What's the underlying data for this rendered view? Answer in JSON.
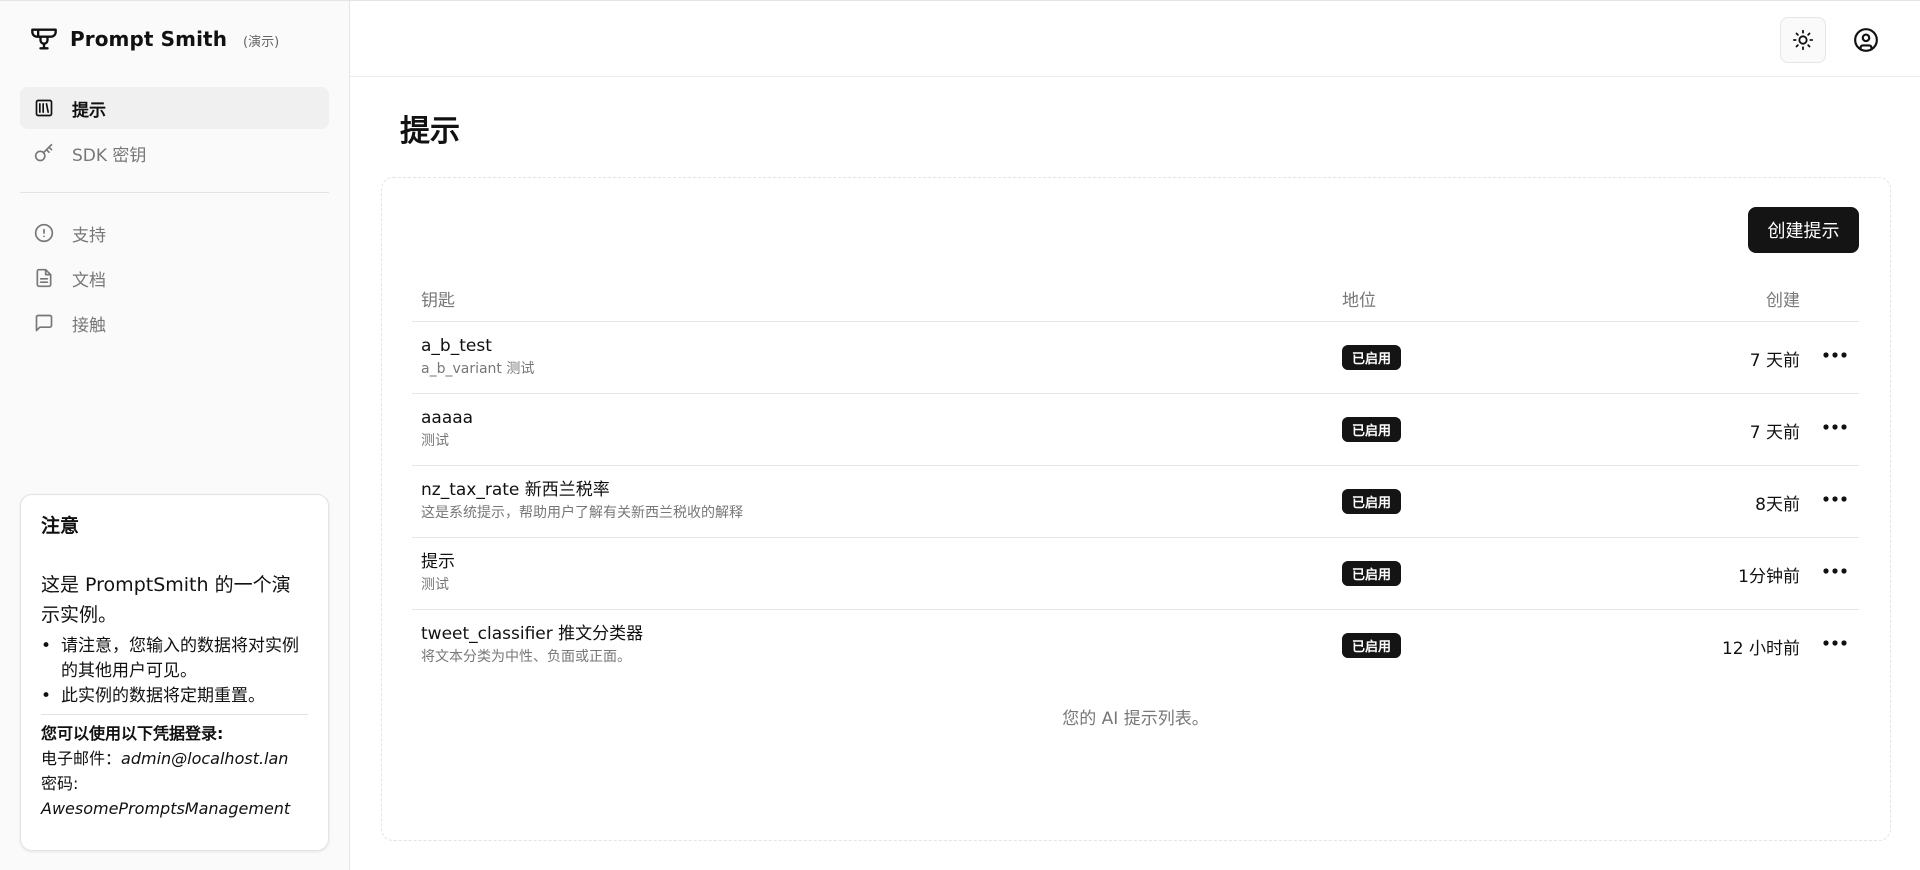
{
  "brand": {
    "name": "Prompt Smith",
    "tag": "(演示)"
  },
  "nav": {
    "items": [
      {
        "label": "提示",
        "icon": "library-icon",
        "active": true
      },
      {
        "label": "SDK 密钥",
        "icon": "key-icon",
        "active": false
      }
    ],
    "secondary": [
      {
        "label": "支持",
        "icon": "alert-circle-icon"
      },
      {
        "label": "文档",
        "icon": "file-text-icon"
      },
      {
        "label": "接触",
        "icon": "message-square-icon"
      }
    ]
  },
  "notice": {
    "title": "注意",
    "body": "这是 PromptSmith 的一个演示实例。",
    "bullets": [
      "请注意，您输入的数据将对实例的其他用户可见。",
      "此实例的数据将定期重置。"
    ],
    "cred_title": "您可以使用以下凭据登录:",
    "email_label": "电子邮件：",
    "email": "admin@localhost.lan",
    "password_label": "密码:",
    "password": "AwesomePromptsManagement"
  },
  "header": {
    "theme_icon": "sun-icon",
    "user_icon": "user-circle-icon"
  },
  "main": {
    "title": "提示",
    "create_label": "创建提示",
    "columns": {
      "key": "钥匙",
      "status": "地位",
      "created": "创建"
    },
    "rows": [
      {
        "name": "a_b_test",
        "desc": "a_b_variant 测试",
        "status": "已启用",
        "created": "7 天前"
      },
      {
        "name": "aaaaa",
        "desc": "测试",
        "status": "已启用",
        "created": "7 天前"
      },
      {
        "name": "nz_tax_rate 新西兰税率",
        "desc": "这是系统提示，帮助用户了解有关新西兰税收的解释",
        "status": "已启用",
        "created": "8天前"
      },
      {
        "name": "提示",
        "desc": "测试",
        "status": "已启用",
        "created": "1分钟前"
      },
      {
        "name": "tweet_classifier 推文分类器",
        "desc": "将文本分类为中性、负面或正面。",
        "status": "已启用",
        "created": "12 小时前"
      }
    ],
    "caption": "您的 AI 提示列表。"
  }
}
